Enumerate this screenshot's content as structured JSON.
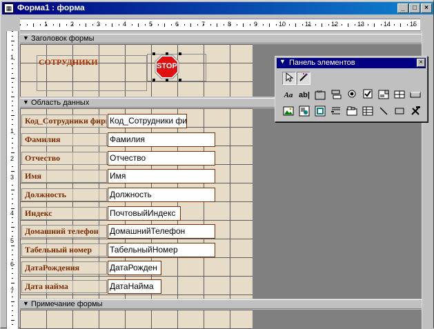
{
  "window": {
    "title": "Форма1 : форма",
    "minimize": "_",
    "maximize": "□",
    "close": "×"
  },
  "ruler": {
    "h_numbers": [
      "1",
      "2",
      "3",
      "4",
      "5",
      "6",
      "7",
      "8",
      "9",
      "10",
      "11",
      "12",
      "13",
      "14",
      "15"
    ],
    "v_numbers": [
      "1",
      "1",
      "2",
      "3",
      "4",
      "5",
      "6",
      "7"
    ]
  },
  "sections": {
    "header": "Заголовок формы",
    "detail": "Область данных",
    "footer": "Примечание формы"
  },
  "header": {
    "title": "СОТРУДНИКИ",
    "stop_text": "STOP"
  },
  "fields": [
    {
      "label": "Код_Сотрудники фирмы",
      "value": "Код_Сотрудники фи"
    },
    {
      "label": "Фамилия",
      "value": "Фамилия"
    },
    {
      "label": "Отчество",
      "value": "Отчество"
    },
    {
      "label": "Имя",
      "value": "Имя"
    },
    {
      "label": "Должность",
      "value": "Должность"
    },
    {
      "label": "Индекс",
      "value": "ПочтовыйИндекс"
    },
    {
      "label": "Домашний телефон",
      "value": "ДомашнийТелефон"
    },
    {
      "label": "Табельный номер",
      "value": "ТабельныйНомер"
    },
    {
      "label": "ДатаРождения",
      "value": "ДатаРожден"
    },
    {
      "label": "Дата найма",
      "value": "ДатаНайма"
    }
  ],
  "toolbox": {
    "title": "Панель элементов",
    "close": "×",
    "row1": [
      "select-pointer",
      "wizard"
    ],
    "row2": [
      "Aa",
      "ab|",
      "xyz",
      "toggle",
      "radio",
      "check",
      "combo",
      "list",
      "button"
    ],
    "row3": [
      "image",
      "unbound-frame",
      "bound-frame",
      "page-break",
      "tab",
      "subform",
      "line",
      "rectangle",
      "more-tools"
    ]
  }
}
